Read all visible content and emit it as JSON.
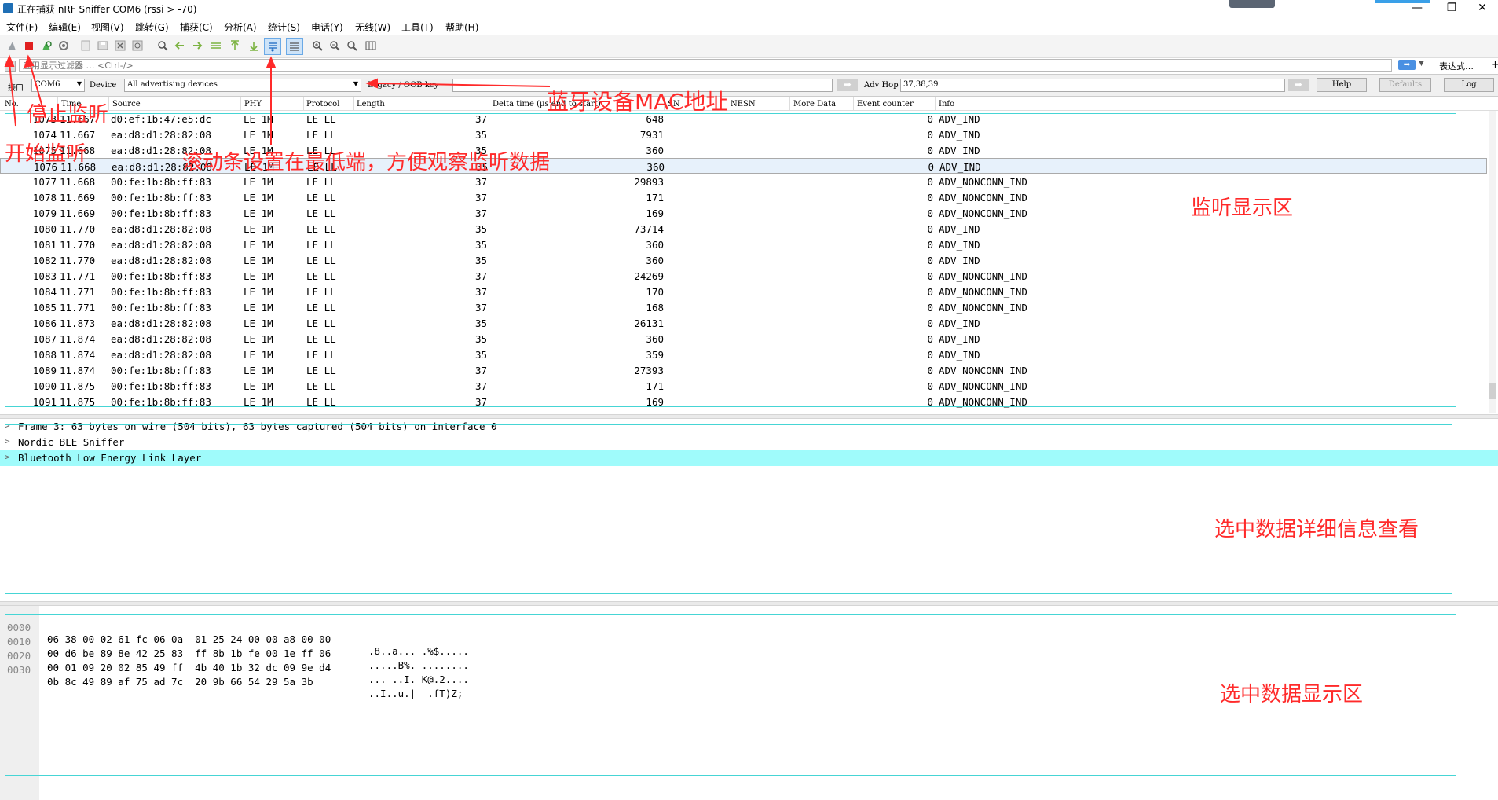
{
  "window": {
    "title": "正在捕获 nRF Sniffer COM6 (rssi > -70)",
    "controls": [
      "—",
      "❐",
      "✕"
    ]
  },
  "menu": [
    "文件(F)",
    "编辑(E)",
    "视图(V)",
    "跳转(G)",
    "捕获(C)",
    "分析(A)",
    "统计(S)",
    "电话(Y)",
    "无线(W)",
    "工具(T)",
    "帮助(H)"
  ],
  "toolbar": {
    "icons": [
      "start-capture-icon",
      "stop-capture-icon",
      "restart-capture-icon",
      "capture-options-icon",
      "open-file-icon",
      "save-file-icon",
      "close-file-icon",
      "reload-file-icon",
      "find-packet-icon",
      "go-back-icon",
      "go-forward-icon",
      "go-to-packet-icon",
      "go-first-icon",
      "go-last-icon",
      "autoscroll-icon",
      "colorize-icon",
      "zoom-in-icon",
      "zoom-out-icon",
      "zoom-normal-icon",
      "resize-columns-icon"
    ]
  },
  "filter": {
    "placeholder": "应用显示过滤器 … <Ctrl-/>",
    "expression_label": "表达式…",
    "add_label": "+"
  },
  "device_bar": {
    "port_label": "接口",
    "port_value": "COM6",
    "device_label": "Device",
    "device_value": "All advertising devices",
    "key_label": "Legacy / OOB key",
    "adv_hop_label": "Adv Hop",
    "adv_hop_value": "37,38,39",
    "help_label": "Help",
    "defaults_label": "Defaults",
    "log_label": "Log"
  },
  "packet_list": {
    "columns": [
      "No.",
      "Time",
      "Source",
      "PHY",
      "Protocol",
      "Length",
      "Delta time (μs end to start)",
      "SN",
      "NESN",
      "More Data",
      "Event counter",
      "Info"
    ],
    "rows": [
      [
        "1073",
        "11.667",
        "d0:ef:1b:47:e5:dc",
        "LE 1M",
        "LE LL",
        "37",
        "648",
        "0",
        "ADV_IND"
      ],
      [
        "1074",
        "11.667",
        "ea:d8:d1:28:82:08",
        "LE 1M",
        "LE LL",
        "35",
        "7931",
        "0",
        "ADV_IND"
      ],
      [
        "1075",
        "11.668",
        "ea:d8:d1:28:82:08",
        "LE 1M",
        "LE LL",
        "35",
        "360",
        "0",
        "ADV_IND"
      ],
      [
        "1076",
        "11.668",
        "ea:d8:d1:28:82:08",
        "LE 1M",
        "LE LL",
        "35",
        "360",
        "0",
        "ADV_IND"
      ],
      [
        "1077",
        "11.668",
        "00:fe:1b:8b:ff:83",
        "LE 1M",
        "LE LL",
        "37",
        "29893",
        "0",
        "ADV_NONCONN_IND"
      ],
      [
        "1078",
        "11.669",
        "00:fe:1b:8b:ff:83",
        "LE 1M",
        "LE LL",
        "37",
        "171",
        "0",
        "ADV_NONCONN_IND"
      ],
      [
        "1079",
        "11.669",
        "00:fe:1b:8b:ff:83",
        "LE 1M",
        "LE LL",
        "37",
        "169",
        "0",
        "ADV_NONCONN_IND"
      ],
      [
        "1080",
        "11.770",
        "ea:d8:d1:28:82:08",
        "LE 1M",
        "LE LL",
        "35",
        "73714",
        "0",
        "ADV_IND"
      ],
      [
        "1081",
        "11.770",
        "ea:d8:d1:28:82:08",
        "LE 1M",
        "LE LL",
        "35",
        "360",
        "0",
        "ADV_IND"
      ],
      [
        "1082",
        "11.770",
        "ea:d8:d1:28:82:08",
        "LE 1M",
        "LE LL",
        "35",
        "360",
        "0",
        "ADV_IND"
      ],
      [
        "1083",
        "11.771",
        "00:fe:1b:8b:ff:83",
        "LE 1M",
        "LE LL",
        "37",
        "24269",
        "0",
        "ADV_NONCONN_IND"
      ],
      [
        "1084",
        "11.771",
        "00:fe:1b:8b:ff:83",
        "LE 1M",
        "LE LL",
        "37",
        "170",
        "0",
        "ADV_NONCONN_IND"
      ],
      [
        "1085",
        "11.771",
        "00:fe:1b:8b:ff:83",
        "LE 1M",
        "LE LL",
        "37",
        "168",
        "0",
        "ADV_NONCONN_IND"
      ],
      [
        "1086",
        "11.873",
        "ea:d8:d1:28:82:08",
        "LE 1M",
        "LE LL",
        "35",
        "26131",
        "0",
        "ADV_IND"
      ],
      [
        "1087",
        "11.874",
        "ea:d8:d1:28:82:08",
        "LE 1M",
        "LE LL",
        "35",
        "360",
        "0",
        "ADV_IND"
      ],
      [
        "1088",
        "11.874",
        "ea:d8:d1:28:82:08",
        "LE 1M",
        "LE LL",
        "35",
        "359",
        "0",
        "ADV_IND"
      ],
      [
        "1089",
        "11.874",
        "00:fe:1b:8b:ff:83",
        "LE 1M",
        "LE LL",
        "37",
        "27393",
        "0",
        "ADV_NONCONN_IND"
      ],
      [
        "1090",
        "11.875",
        "00:fe:1b:8b:ff:83",
        "LE 1M",
        "LE LL",
        "37",
        "171",
        "0",
        "ADV_NONCONN_IND"
      ],
      [
        "1091",
        "11.875",
        "00:fe:1b:8b:ff:83",
        "LE 1M",
        "LE LL",
        "37",
        "169",
        "0",
        "ADV_NONCONN_IND"
      ]
    ]
  },
  "details": [
    "Frame 3: 63 bytes on wire (504 bits), 63 bytes captured (504 bits) on interface 0",
    "Nordic BLE Sniffer",
    "Bluetooth Low Energy Link Layer"
  ],
  "hex": [
    {
      "offset": "0000",
      "bytes": "06 38 00 02 61 fc 06 0a  01 25 24 00 00 a8 00 00",
      "ascii": ".8..a... .%$....."
    },
    {
      "offset": "0010",
      "bytes": "00 d6 be 89 8e 42 25 83  ff 8b 1b fe 00 1e ff 06",
      "ascii": ".....B%. ........"
    },
    {
      "offset": "0020",
      "bytes": "00 01 09 20 02 85 49 ff  4b 40 1b 32 dc 09 9e d4",
      "ascii": "... ..I. K@.2...."
    },
    {
      "offset": "0030",
      "bytes": "0b 8c 49 89 af 75 ad 7c  20 9b 66 54 29 5a 3b",
      "ascii": "..I..u.|  .fT)Z;"
    }
  ],
  "annotations": {
    "stop": "停止监听",
    "start": "开始监听",
    "autoscroll": "滚动条设置在最低端，方便观察监听数据",
    "mac": "蓝牙设备MAC地址",
    "list_area": "监听显示区",
    "detail_area": "选中数据详细信息查看",
    "bytes_area": "选中数据显示区"
  },
  "colors": {
    "annotation": "#ff2a2a",
    "highlight_row": "#9ffbfb",
    "box": "#46d5d5"
  }
}
